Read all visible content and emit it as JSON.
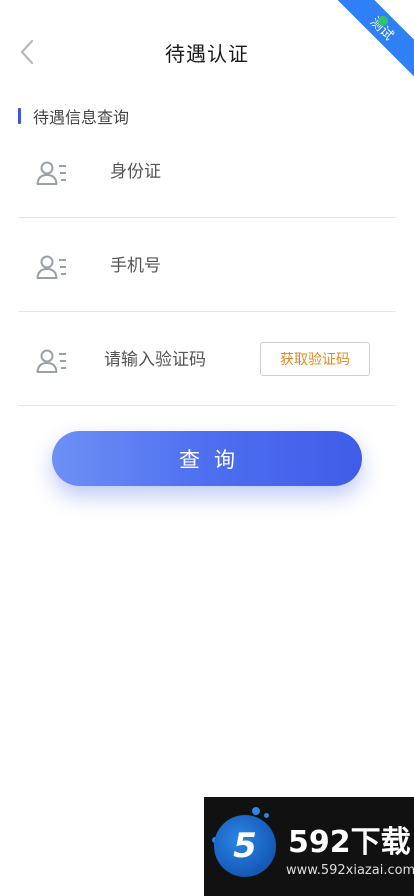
{
  "header": {
    "title": "待遇认证",
    "badge": "测试"
  },
  "section": {
    "title": "待遇信息查询"
  },
  "form": {
    "id_placeholder": "身份证",
    "phone_placeholder": "手机号",
    "code_placeholder": "请输入验证码",
    "get_code_label": "获取验证码",
    "submit_label": "查询"
  },
  "watermark": {
    "logo_digit": "5",
    "name": "592下载",
    "url": "www.592xiazai.com"
  },
  "colors": {
    "accent": "#3f5ce8",
    "code_text": "#e0891e",
    "ribbon": "#2f7ff5"
  },
  "icons": {
    "back": "chevron-left-icon",
    "user": "user-card-icon"
  }
}
